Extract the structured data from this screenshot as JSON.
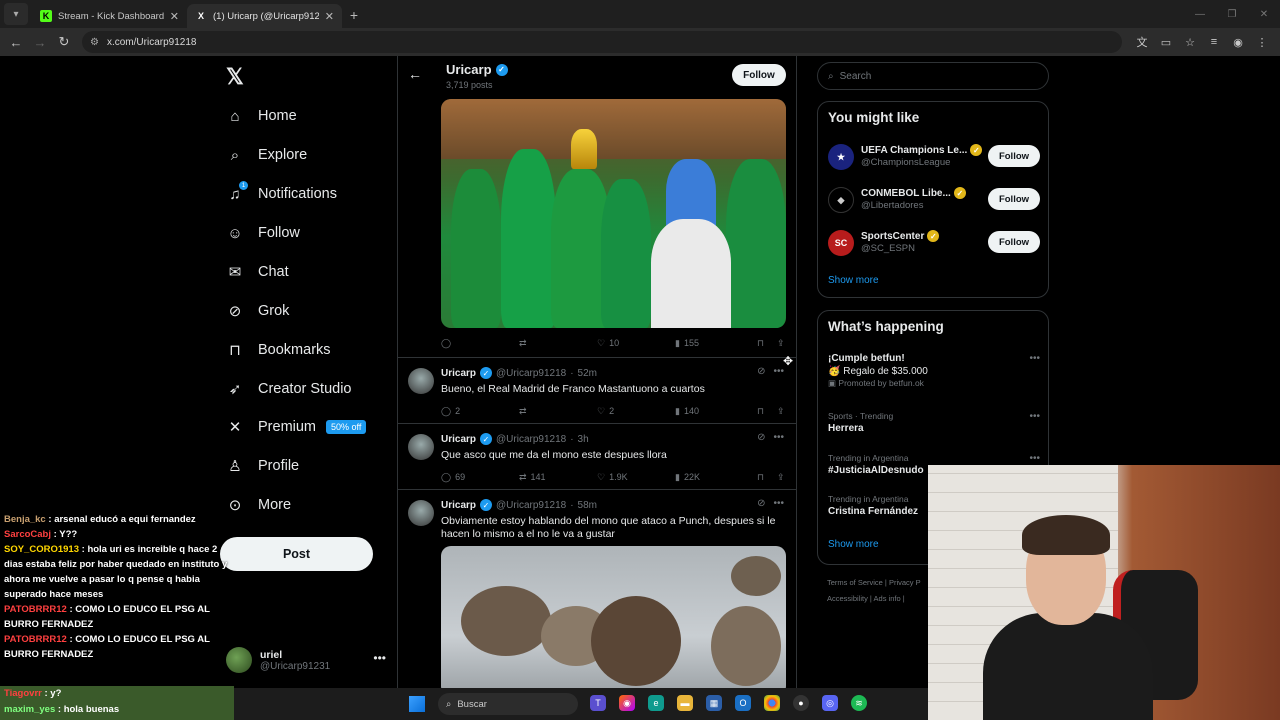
{
  "browser": {
    "tabs": [
      {
        "label": "Stream - Kick Dashboard",
        "favicon": "K"
      },
      {
        "label": "(1) Uricarp (@Uricarp91218) / X",
        "favicon": "X"
      }
    ],
    "url": "x.com/Uricarp91218"
  },
  "sidebar": {
    "items": [
      {
        "label": "Home",
        "icon": "home-icon"
      },
      {
        "label": "Explore",
        "icon": "search-icon"
      },
      {
        "label": "Notifications",
        "icon": "bell-icon",
        "badge": "1"
      },
      {
        "label": "Follow",
        "icon": "person-add-icon"
      },
      {
        "label": "Chat",
        "icon": "mail-icon"
      },
      {
        "label": "Grok",
        "icon": "grok-icon"
      },
      {
        "label": "Bookmarks",
        "icon": "bookmark-icon"
      },
      {
        "label": "Creator Studio",
        "icon": "rocket-icon"
      },
      {
        "label": "Premium",
        "icon": "x-icon",
        "badge": "50% off"
      },
      {
        "label": "Profile",
        "icon": "person-icon"
      },
      {
        "label": "More",
        "icon": "more-circle-icon"
      }
    ],
    "post_label": "Post",
    "account": {
      "name": "uriel",
      "handle": "@Uricarp91231"
    }
  },
  "profile_header": {
    "name": "Uricarp",
    "posts": "3,719 posts",
    "follow_label": "Follow"
  },
  "first_post_actions": {
    "replies": "",
    "reposts": "",
    "likes": "10",
    "views": "155"
  },
  "tweets": [
    {
      "name": "Uricarp",
      "handle": "@Uricarp91218",
      "time": "52m",
      "text": "Bueno, el Real Madrid de Franco Mastantuono a cuartos",
      "replies": "2",
      "reposts": "",
      "likes": "2",
      "views": "140"
    },
    {
      "name": "Uricarp",
      "handle": "@Uricarp91218",
      "time": "3h",
      "text": "Que asco que me da el mono este despues llora",
      "replies": "69",
      "reposts": "141",
      "likes": "1.9K",
      "views": "22K"
    },
    {
      "name": "Uricarp",
      "handle": "@Uricarp91218",
      "time": "58m",
      "text": "Obviamente estoy hablando del mono que ataco a Punch, despues si le hacen lo mismo a el no le va a gustar"
    }
  ],
  "search": {
    "placeholder": "Search"
  },
  "you_might_like": {
    "title": "You might like",
    "accounts": [
      {
        "name": "UEFA Champions Le...",
        "handle": "@ChampionsLeague",
        "follow": "Follow",
        "logo_color": "#1a237e"
      },
      {
        "name": "CONMEBOL Libe...",
        "handle": "@Libertadores",
        "follow": "Follow",
        "logo_color": "#000000"
      },
      {
        "name": "SportsCenter",
        "handle": "@SC_ESPN",
        "follow": "Follow",
        "logo_color": "#b71c1c"
      }
    ],
    "show_more": "Show more"
  },
  "whats_happening": {
    "title": "What’s happening",
    "trends": [
      {
        "context": "",
        "topic": "¡Cumple betfun!",
        "extra": "Regalo de $35.000",
        "promo": "Promoted by betfun.ok"
      },
      {
        "context": "Sports · Trending",
        "topic": "Herrera"
      },
      {
        "context": "Trending in Argentina",
        "topic": "#JusticiaAlDesnudo"
      },
      {
        "context": "Trending in Argentina",
        "topic": "Cristina Fernández"
      }
    ],
    "show_more": "Show more"
  },
  "footer": {
    "line1": "Terms of Service  |  Privacy P",
    "line2": "Accessibility  |  Ads info  |"
  },
  "chat": {
    "messages": [
      {
        "user": "Benja_kc",
        "color": "#c8a070",
        "text": "arsenal educó a equi fernandez"
      },
      {
        "user": "SarcoCabj",
        "color": "#ff4040",
        "text": "Y??"
      },
      {
        "user": "SOY_CORO1913",
        "color": "#ffd700",
        "text": "hola uri es increible q hace 2 dias estaba feliz por haber quedado en instituto y ahora me vuelve a pasar lo q pense q habia superado hace meses"
      },
      {
        "user": "PATOBRRR12",
        "color": "#ff4040",
        "text": "COMO LO EDUCO EL PSG AL BURRO FERNADEZ"
      },
      {
        "user": "PATOBRRR12",
        "color": "#ff4040",
        "text": "COMO LO EDUCO EL PSG AL BURRO FERNADEZ"
      },
      {
        "user": "Tiagovrr",
        "color": "#ff4040",
        "text": "y?"
      },
      {
        "user": "maxim_yes",
        "color": "#7fff7f",
        "text": "hola buenas"
      }
    ]
  },
  "taskbar": {
    "search_placeholder": "Buscar"
  }
}
